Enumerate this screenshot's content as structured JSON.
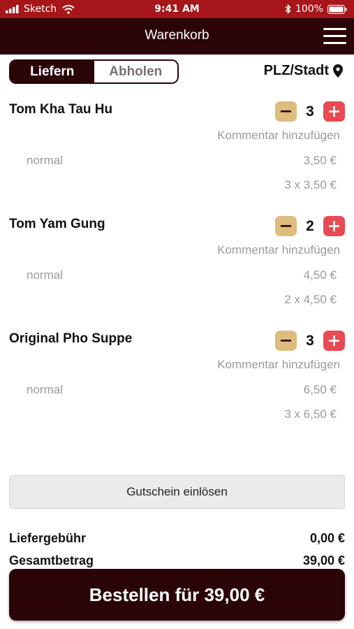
{
  "status_bar": {
    "carrier": "Sketch",
    "time": "9:41 AM",
    "battery": "100%"
  },
  "header": {
    "title": "Warenkorb",
    "menu_icon": "hamburger-menu-icon"
  },
  "delivery_toggle": {
    "options": [
      "Liefern",
      "Abholen"
    ],
    "selected": "Liefern"
  },
  "location": {
    "label": "PLZ/Stadt",
    "icon": "location-pin-icon"
  },
  "cart_items": [
    {
      "name": "Tom Kha Tau Hu",
      "quantity": "3",
      "comment_label": "Kommentar hinzufügen",
      "variant": "normal",
      "unit_price": "3,50 €",
      "line_total": "3 x 3,50 €"
    },
    {
      "name": "Tom Yam Gung",
      "quantity": "2",
      "comment_label": "Kommentar hinzufügen",
      "variant": "normal",
      "unit_price": "4,50 €",
      "line_total": "2 x 4,50 €"
    },
    {
      "name": "Original Pho Suppe",
      "quantity": "3",
      "comment_label": "Kommentar hinzufügen",
      "variant": "normal",
      "unit_price": "6,50 €",
      "line_total": "3 x 6,50 €"
    }
  ],
  "voucher_button": "Gutschein einlösen",
  "summary": {
    "delivery_fee_label": "Liefergebühr",
    "delivery_fee": "0,00 €",
    "total_label": "Gesamtbetrag",
    "total": "39,00 €"
  },
  "order_button": "Bestellen für 39,00 €",
  "colors": {
    "status_bar": "#a7161a",
    "primary": "#2b0407",
    "minus_button": "#ddbc7e",
    "plus_button": "#e84a55",
    "muted_text": "#9a9a9a"
  }
}
